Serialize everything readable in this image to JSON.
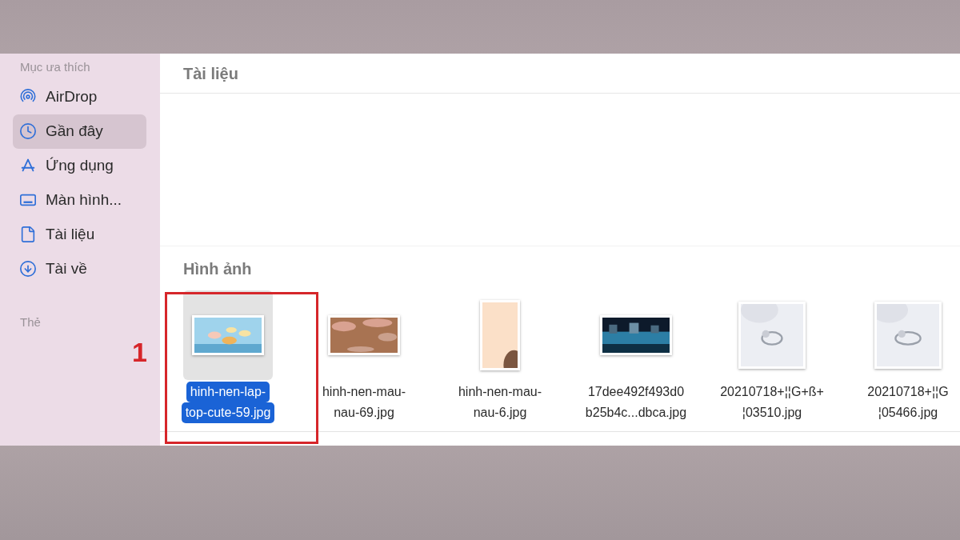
{
  "sidebar": {
    "sections": [
      {
        "title": "Mục ưa thích",
        "items": [
          {
            "label": "AirDrop",
            "kind": "airdrop",
            "selected": false
          },
          {
            "label": "Gần đây",
            "kind": "recent",
            "selected": true
          },
          {
            "label": "Ứng dụng",
            "kind": "applications",
            "selected": false
          },
          {
            "label": "Màn hình...",
            "kind": "desktop",
            "selected": false
          },
          {
            "label": "Tài liệu",
            "kind": "documents",
            "selected": false
          },
          {
            "label": "Tài về",
            "kind": "downloads",
            "selected": false
          }
        ]
      },
      {
        "title": "Thẻ"
      }
    ]
  },
  "groups": [
    {
      "title": "Tài liệu"
    },
    {
      "title": "Hình ảnh",
      "files": [
        {
          "lines": [
            "hinh-nen-lap-",
            "top-cute-59.jpg"
          ],
          "selected": true
        },
        {
          "lines": [
            "hinh-nen-mau-",
            "nau-69.jpg"
          ],
          "selected": false
        },
        {
          "lines": [
            "hinh-nen-mau-",
            "nau-6.jpg"
          ],
          "selected": false
        },
        {
          "lines": [
            "17dee492f493d0",
            "b25b4c...dbca.jpg"
          ],
          "selected": false
        },
        {
          "lines": [
            "20210718+¦¦G+ß+",
            "¦03510.jpg"
          ],
          "selected": false
        },
        {
          "lines": [
            "20210718+¦¦G",
            "¦05466.jpg"
          ],
          "selected": false
        }
      ]
    }
  ],
  "annotation": {
    "label": "1"
  }
}
